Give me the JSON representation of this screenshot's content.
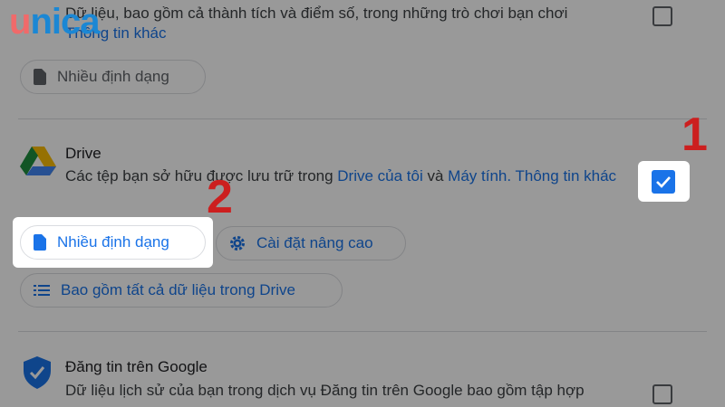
{
  "logo": {
    "first": "u",
    "rest": "nica"
  },
  "top_section": {
    "desc_line1": "Dữ liệu, bao gồm cả thành tích và điểm số, trong những trò chơi bạn chơi",
    "info_link": "Thông tin khác",
    "format_chip": "Nhiều định dạng"
  },
  "drive_section": {
    "title": "Drive",
    "desc_prefix": "Các tệp bạn sở hữu được lưu trữ trong ",
    "link_my_drive": "Drive của tôi",
    "and_text": " và ",
    "link_computer": "Máy tính.",
    "link_more": "Thông tin khác",
    "format_chip": "Nhiều định dạng",
    "advanced_chip": "Cài đặt nâng cao",
    "include_all_chip": "Bao gồm tất cả dữ liệu trong Drive"
  },
  "posts_section": {
    "title": "Đăng tin trên Google",
    "desc": "Dữ liệu lịch sử của bạn trong dịch vụ Đăng tin trên Google bao gồm tập hợp"
  },
  "annotations": {
    "step1": "1",
    "step2": "2"
  },
  "colors": {
    "accent": "#1a73e8",
    "annotation": "#cc1f1f",
    "drive_green": "#1e8e3e",
    "drive_yellow": "#fbbc04",
    "drive_blue": "#4285f4"
  },
  "icons": [
    "file-icon",
    "drive-logo-icon",
    "gear-icon",
    "list-icon",
    "shield-check-icon",
    "checkbox-icon",
    "checkmark-icon"
  ]
}
